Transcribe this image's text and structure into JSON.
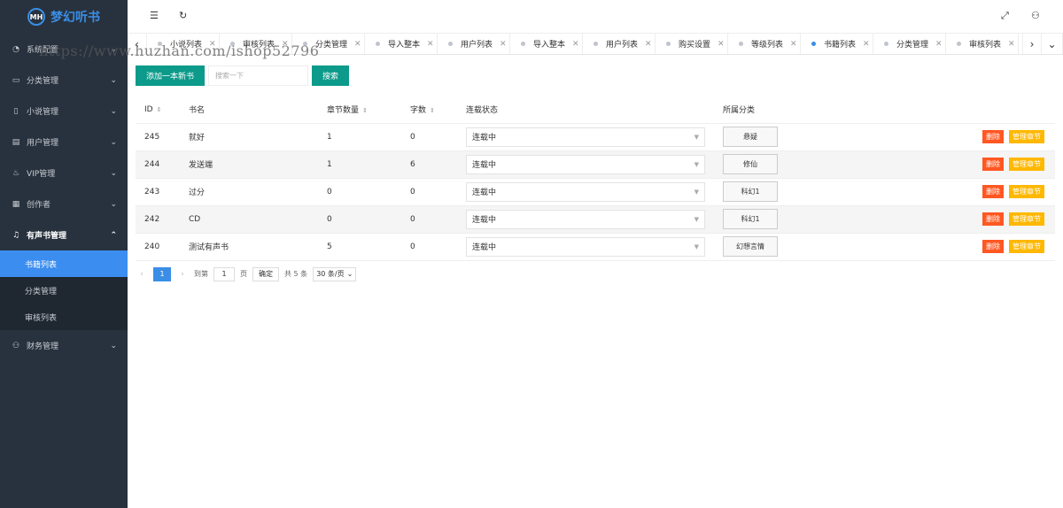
{
  "app": {
    "logo_badge": "MH",
    "name": "梦幻听书"
  },
  "sidebar": {
    "items": [
      {
        "label": "系统配置",
        "icon": "dashboard-icon"
      },
      {
        "label": "分类管理",
        "icon": "folder-icon"
      },
      {
        "label": "小说管理",
        "icon": "book-icon"
      },
      {
        "label": "用户管理",
        "icon": "user-card-icon"
      },
      {
        "label": "VIP管理",
        "icon": "fire-icon"
      },
      {
        "label": "创作者",
        "icon": "calendar-icon"
      },
      {
        "label": "有声书管理",
        "icon": "bell-icon"
      }
    ],
    "submenu": [
      {
        "label": "书籍列表",
        "active": true
      },
      {
        "label": "分类管理",
        "active": false
      },
      {
        "label": "审核列表",
        "active": false
      }
    ],
    "last_item": {
      "label": "财务管理",
      "icon": "person-icon"
    }
  },
  "tabs": [
    {
      "label": "小说列表",
      "active": false
    },
    {
      "label": "审核列表",
      "active": false
    },
    {
      "label": "分类管理",
      "active": false
    },
    {
      "label": "导入整本",
      "active": false
    },
    {
      "label": "用户列表",
      "active": false
    },
    {
      "label": "导入整本",
      "active": false
    },
    {
      "label": "用户列表",
      "active": false
    },
    {
      "label": "购买设置",
      "active": false
    },
    {
      "label": "等级列表",
      "active": false
    },
    {
      "label": "书籍列表",
      "active": true
    },
    {
      "label": "分类管理",
      "active": false
    },
    {
      "label": "审核列表",
      "active": false
    }
  ],
  "toolbar": {
    "add_label": "添加一本新书",
    "search_placeholder": "搜索一下",
    "search_label": "搜索"
  },
  "table": {
    "headers": {
      "id": "ID",
      "name": "书名",
      "chapters": "章节数量",
      "words": "字数",
      "status": "连载状态",
      "category": "所属分类"
    },
    "rows": [
      {
        "id": "245",
        "name": "就好",
        "chapters": "1",
        "words": "0",
        "status": "连载中",
        "category": "悬疑"
      },
      {
        "id": "244",
        "name": "发送端",
        "chapters": "1",
        "words": "6",
        "status": "连载中",
        "category": "修仙"
      },
      {
        "id": "243",
        "name": "过分",
        "chapters": "0",
        "words": "0",
        "status": "连载中",
        "category": "科幻1"
      },
      {
        "id": "242",
        "name": "CD",
        "chapters": "0",
        "words": "0",
        "status": "连载中",
        "category": "科幻1"
      },
      {
        "id": "240",
        "name": "测试有声书",
        "chapters": "5",
        "words": "0",
        "status": "连载中",
        "category": "幻想言情"
      }
    ],
    "delete_label": "删除",
    "manage_label": "管理章节"
  },
  "pager": {
    "current": "1",
    "goto_label": "到第",
    "goto_value": "1",
    "page_unit": "页",
    "confirm_label": "确定",
    "total_label": "共 5 条",
    "size_label": "30 条/页"
  },
  "watermark": "https://www.huzhan.com/ishop52796",
  "colors": {
    "sidebar_bg": "#28323e",
    "accent": "#3a8ee6",
    "primary_btn": "#0c9a8a",
    "danger": "#ff5722",
    "warning": "#ffb800"
  }
}
